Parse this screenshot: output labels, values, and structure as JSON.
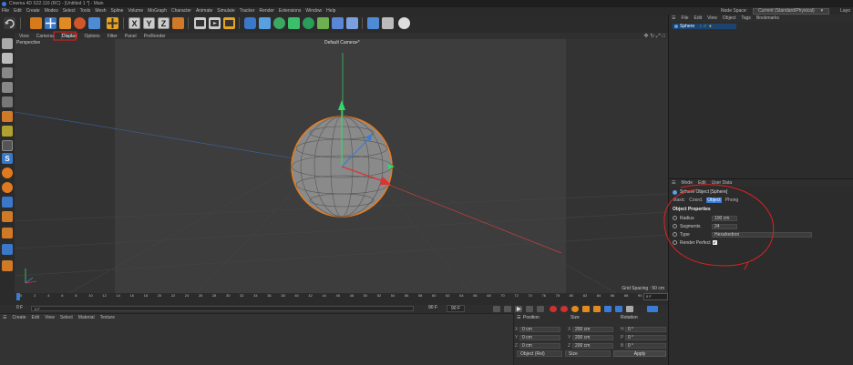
{
  "window": {
    "title": "Cinema 4D S22.116 (RC) - [Untitled 1 *] - Main"
  },
  "menubar": {
    "items": [
      "File",
      "Edit",
      "Create",
      "Modes",
      "Select",
      "Tools",
      "Mesh",
      "Spline",
      "Volume",
      "MoGraph",
      "Character",
      "Animate",
      "Simulate",
      "Tracker",
      "Render",
      "Extensions",
      "Window",
      "Help"
    ],
    "node_space_label": "Node Space:",
    "node_space_value": "Current (Standard/Physical)",
    "layout_label": "Layo"
  },
  "toolbar": {
    "axis_buttons": [
      "X",
      "Y",
      "Z"
    ],
    "icons": [
      "undo-icon",
      "move-icon",
      "scale-icon",
      "rotate-icon",
      "live-select-icon",
      "world-coord-icon",
      "render-view-icon",
      "render-picture-viewer-icon",
      "edit-render-settings-icon",
      "cube-icon",
      "pen-icon",
      "subdivision-icon",
      "cloner-icon",
      "field-icon",
      "deformer-icon",
      "environment-icon",
      "camera-icon",
      "light-icon"
    ]
  },
  "viewport": {
    "menu": [
      "View",
      "Cameras",
      "Display",
      "Options",
      "Filter",
      "Panel",
      "ProRender"
    ],
    "highlighted_menu": "Display",
    "perspective_label": "Perspective",
    "camera_label": "Default Camera",
    "camera_suffix": "•*",
    "grid_spacing": "Grid Spacing : 50 cm",
    "nav_icons": "✥ ↻ ⤢ □",
    "colors": {
      "sphere": "#888888",
      "selection": "#e87d1e",
      "y_axis": "#37d66a",
      "x_axis": "#e03030",
      "z_axis": "#3a7bd5"
    }
  },
  "timeline": {
    "ticks": [
      "0",
      "2",
      "4",
      "6",
      "8",
      "10",
      "12",
      "14",
      "16",
      "18",
      "20",
      "22",
      "24",
      "26",
      "28",
      "30",
      "32",
      "34",
      "36",
      "38",
      "40",
      "42",
      "44",
      "46",
      "48",
      "50",
      "52",
      "54",
      "56",
      "58",
      "60",
      "62",
      "64",
      "66",
      "68",
      "70",
      "72",
      "74",
      "76",
      "78",
      "80",
      "82",
      "84",
      "86",
      "88",
      "90"
    ],
    "end_frame": "0 F",
    "current_frame": "0 F",
    "slider_frame": "0 F",
    "cur_frame_right": "90 F",
    "max_frame": "90 F"
  },
  "material_manager": {
    "menu": [
      "Create",
      "Edit",
      "View",
      "Select",
      "Material",
      "Texture"
    ]
  },
  "coordinates": {
    "headers": {
      "position": "Position",
      "size": "Size",
      "rotation": "Rotation"
    },
    "rows": [
      {
        "axis": "X",
        "position": "0 cm",
        "size_axis": "X",
        "size": "200 cm",
        "rot_axis": "H",
        "rotation": "0 °"
      },
      {
        "axis": "Y",
        "position": "0 cm",
        "size_axis": "Y",
        "size": "200 cm",
        "rot_axis": "P",
        "rotation": "0 °"
      },
      {
        "axis": "Z",
        "position": "0 cm",
        "size_axis": "Z",
        "size": "200 cm",
        "rot_axis": "B",
        "rotation": "0 °"
      }
    ],
    "mode_select": "Object (Rel)",
    "size_select": "Size",
    "apply_label": "Apply"
  },
  "object_manager": {
    "menu": [
      "File",
      "Edit",
      "View",
      "Object",
      "Tags",
      "Bookmarks"
    ],
    "objects": [
      {
        "name": "Sphere"
      }
    ]
  },
  "attribute_manager": {
    "menu": [
      "Mode",
      "Edit",
      "User Data"
    ],
    "object_title": "Sphere Object [Sphere]",
    "tabs": [
      "Basic",
      "Coord.",
      "Object",
      "Phong"
    ],
    "active_tab": "Object",
    "section": "Object Properties",
    "properties": [
      {
        "label": "Radius",
        "value": "100 cm"
      },
      {
        "label": "Segments",
        "value": "24"
      },
      {
        "label": "Type",
        "value": "Hexahedron"
      },
      {
        "label": "Render Perfect",
        "value": "✔"
      }
    ]
  }
}
